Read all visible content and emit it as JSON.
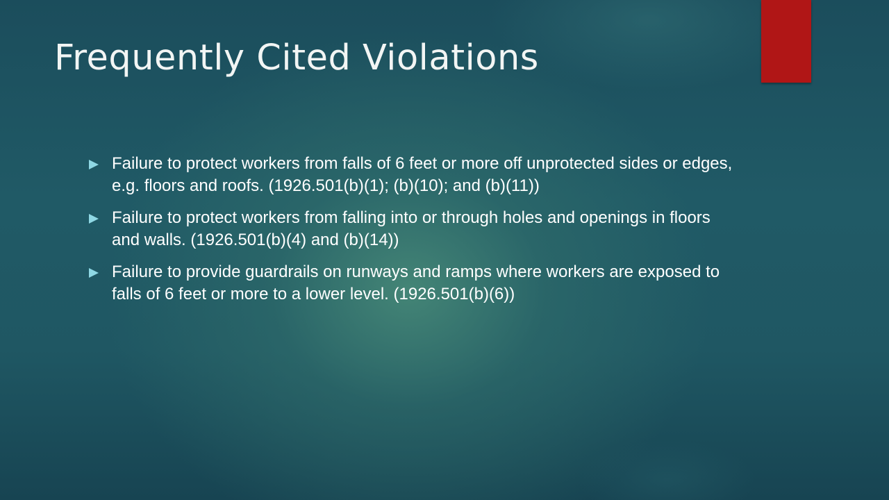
{
  "slide": {
    "title": "Frequently Cited Violations",
    "accent_color": "#b01616",
    "bullet_color": "#8fd8e4",
    "bullets": [
      "Failure to protect workers from falls of 6 feet or more off unprotected sides or edges, e.g. floors and roofs. (1926.501(b)(1); (b)(10); and (b)(11))",
      "Failure to protect workers from falling into or through holes and openings in floors and walls. (1926.501(b)(4) and (b)(14))",
      "Failure to provide guardrails on runways and ramps where workers are exposed to falls of 6 feet or more to a lower level. (1926.501(b)(6))"
    ]
  }
}
